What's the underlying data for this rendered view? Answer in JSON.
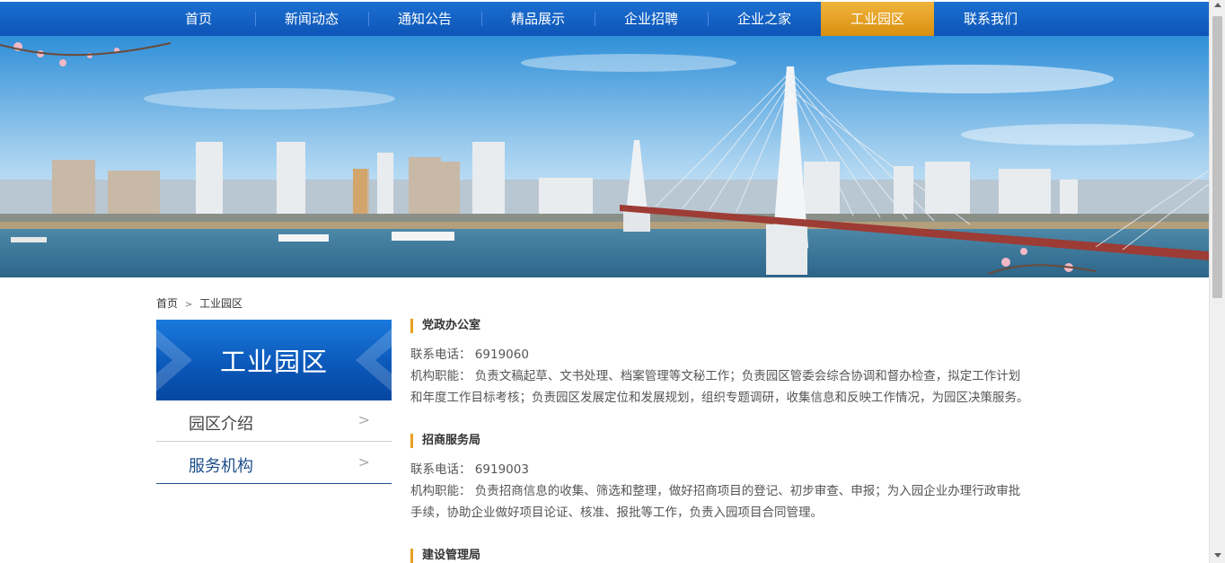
{
  "nav": {
    "items": [
      {
        "label": "首页"
      },
      {
        "label": "新闻动态"
      },
      {
        "label": "通知公告"
      },
      {
        "label": "精品展示"
      },
      {
        "label": "企业招聘"
      },
      {
        "label": "企业之家"
      },
      {
        "label": "工业园区"
      },
      {
        "label": "联系我们"
      }
    ],
    "active_index": 6
  },
  "breadcrumb": {
    "home": "首页",
    "separator": ">",
    "current": "工业园区"
  },
  "sidebar": {
    "title": "工业园区",
    "items": [
      {
        "label": "园区介绍",
        "arrow": ">"
      },
      {
        "label": "服务机构",
        "arrow": ">"
      }
    ]
  },
  "sections": [
    {
      "title": "党政办公室",
      "phone_label": "联系电话：",
      "phone": "6919060",
      "duty_label": "机构职能：",
      "duty_1": "负责文稿起草、文书处理、档案管理等文秘工作；负责园区管委会综合协调和督办检查，拟定工作计划",
      "duty_2": "和年度工作目标考核；负责园区发展定位和发展规划，组织专题调研，收集信息和反映工作情况，为园区决策服务。"
    },
    {
      "title": "招商服务局",
      "phone_label": "联系电话：",
      "phone": "6919003",
      "duty_label": "机构职能：",
      "duty_1": "负责招商信息的收集、筛选和整理，做好招商项目的登记、初步审查、申报；为入园企业办理行政审批",
      "duty_2": "手续，协助企业做好项目论证、核准、报批等工作，负责入园项目合同管理。"
    },
    {
      "title": "建设管理局"
    }
  ],
  "colors": {
    "nav_blue": "#0d55b6",
    "nav_active": "#e7a21f",
    "accent_bar": "#e7a21f",
    "sidebar_blue": "#0a56b7"
  }
}
